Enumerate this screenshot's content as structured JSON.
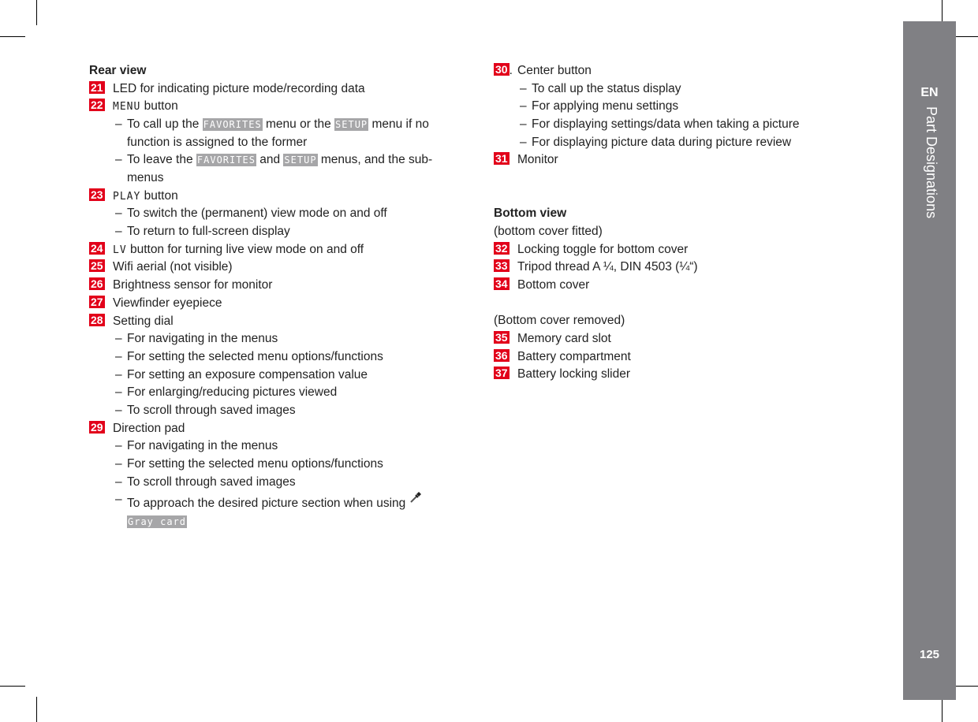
{
  "sidebar": {
    "lang": "EN",
    "section": "Part Designations",
    "page": "125"
  },
  "colors": {
    "badge": "#e2001a",
    "sidebar": "#808084",
    "keyword_bg": "#a6a6a8"
  },
  "left_column": [
    {
      "type": "heading",
      "text": "Rear view"
    },
    {
      "type": "item",
      "num": "21",
      "parts": [
        {
          "t": "LED for indicating picture mode/recording data"
        }
      ]
    },
    {
      "type": "item",
      "num": "22",
      "parts": [
        {
          "m": "MENU"
        },
        {
          "t": " button"
        }
      ]
    },
    {
      "type": "sub",
      "parts": [
        {
          "t": "To call up the "
        },
        {
          "k": "FAVORITES"
        },
        {
          "t": " menu or the "
        },
        {
          "k": "SETUP"
        },
        {
          "t": " menu if no function is assigned to the former"
        }
      ]
    },
    {
      "type": "sub",
      "parts": [
        {
          "t": "To leave the "
        },
        {
          "k": "FAVORITES"
        },
        {
          "t": " and "
        },
        {
          "k": "SETUP"
        },
        {
          "t": " menus, and the sub-menus"
        }
      ]
    },
    {
      "type": "item",
      "num": "23",
      "parts": [
        {
          "m": "PLAY"
        },
        {
          "t": " button"
        }
      ]
    },
    {
      "type": "sub",
      "parts": [
        {
          "t": "To switch the (permanent) view mode on and off"
        }
      ]
    },
    {
      "type": "sub",
      "parts": [
        {
          "t": "To return to full-screen display"
        }
      ]
    },
    {
      "type": "item",
      "num": "24",
      "parts": [
        {
          "m": "LV"
        },
        {
          "t": " button for turning live view mode on and off"
        }
      ]
    },
    {
      "type": "item",
      "num": "25",
      "parts": [
        {
          "t": "Wifi aerial (not visible)"
        }
      ]
    },
    {
      "type": "item",
      "num": "26",
      "parts": [
        {
          "t": "Brightness sensor for monitor"
        }
      ]
    },
    {
      "type": "item",
      "num": "27",
      "parts": [
        {
          "t": "Viewfinder eyepiece"
        }
      ]
    },
    {
      "type": "item",
      "num": "28",
      "parts": [
        {
          "t": "Setting dial"
        }
      ]
    },
    {
      "type": "sub",
      "parts": [
        {
          "t": "For navigating in the menus"
        }
      ]
    },
    {
      "type": "sub",
      "parts": [
        {
          "t": "For setting the selected menu options/functions"
        }
      ]
    },
    {
      "type": "sub",
      "parts": [
        {
          "t": "For setting an exposure compensation value"
        }
      ]
    },
    {
      "type": "sub",
      "parts": [
        {
          "t": "For enlarging/reducing pictures viewed"
        }
      ]
    },
    {
      "type": "sub",
      "parts": [
        {
          "t": "To scroll through saved images"
        }
      ]
    },
    {
      "type": "item",
      "num": "29",
      "parts": [
        {
          "t": "Direction pad"
        }
      ]
    },
    {
      "type": "sub",
      "parts": [
        {
          "t": "For navigating in the menus"
        }
      ]
    },
    {
      "type": "sub",
      "parts": [
        {
          "t": "For setting the selected menu options/functions"
        }
      ]
    },
    {
      "type": "sub",
      "parts": [
        {
          "t": "To scroll through saved images"
        }
      ]
    },
    {
      "type": "sub",
      "parts": [
        {
          "t": "To approach the desired picture section when using "
        },
        {
          "i": "eyedropper-icon"
        },
        {
          "t": " "
        },
        {
          "k": "Gray card"
        }
      ]
    }
  ],
  "right_column": [
    {
      "type": "item",
      "num": "30",
      "suffix": ".",
      "parts": [
        {
          "t": "Center button"
        }
      ]
    },
    {
      "type": "sub",
      "parts": [
        {
          "t": "To call up the status display"
        }
      ]
    },
    {
      "type": "sub",
      "parts": [
        {
          "t": "For applying menu settings"
        }
      ]
    },
    {
      "type": "sub",
      "parts": [
        {
          "t": "For displaying settings/data when taking a picture"
        }
      ]
    },
    {
      "type": "sub",
      "parts": [
        {
          "t": "For displaying picture data during picture review"
        }
      ]
    },
    {
      "type": "item",
      "num": "31",
      "parts": [
        {
          "t": "Monitor"
        }
      ]
    },
    {
      "type": "blank"
    },
    {
      "type": "blank"
    },
    {
      "type": "heading",
      "text": "Bottom view"
    },
    {
      "type": "plain",
      "text": "(bottom cover fitted)"
    },
    {
      "type": "item",
      "num": "32",
      "parts": [
        {
          "t": "Locking toggle for bottom cover"
        }
      ]
    },
    {
      "type": "item",
      "num": "33",
      "parts": [
        {
          "t": "Tripod thread A ¼, DIN 4503 (¼“)"
        }
      ]
    },
    {
      "type": "item",
      "num": "34",
      "parts": [
        {
          "t": "Bottom cover"
        }
      ]
    },
    {
      "type": "blank"
    },
    {
      "type": "plain",
      "text": "(Bottom cover removed)"
    },
    {
      "type": "item",
      "num": "35",
      "parts": [
        {
          "t": "Memory card slot"
        }
      ]
    },
    {
      "type": "item",
      "num": "36",
      "parts": [
        {
          "t": "Battery compartment"
        }
      ]
    },
    {
      "type": "item",
      "num": "37",
      "parts": [
        {
          "t": "Battery locking slider"
        }
      ]
    }
  ]
}
